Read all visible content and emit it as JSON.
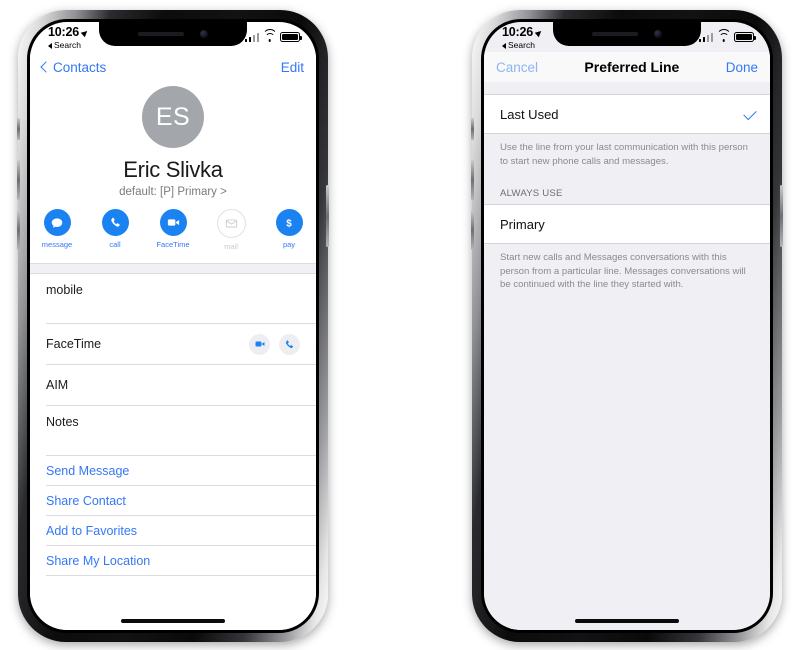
{
  "theme": {
    "accent_blue": "#3478f6",
    "action_blue": "#1b82f2",
    "check_blue": "#2e7cf0",
    "avatar_gray": "#a3a6ab",
    "screen_gray": "#efeff4",
    "separator": "#dcdce0",
    "footnote_gray": "#8a8a8f"
  },
  "status_bar": {
    "time": "10:26",
    "back_label": "Search",
    "location_icon": "location-arrow-icon",
    "signal_icon": "cellular-signal-icon",
    "wifi_icon": "wifi-icon",
    "battery_icon": "battery-icon"
  },
  "left_phone": {
    "nav": {
      "back_label": "Contacts",
      "edit_label": "Edit",
      "back_icon": "chevron-left-icon"
    },
    "contact": {
      "initials": "ES",
      "name": "Eric Slivka",
      "default_line": "default: [P] Primary >"
    },
    "actions": [
      {
        "label": "message",
        "icon": "message-bubble-icon",
        "disabled": false
      },
      {
        "label": "call",
        "icon": "phone-handset-icon",
        "disabled": false
      },
      {
        "label": "FaceTime",
        "icon": "video-camera-icon",
        "disabled": false
      },
      {
        "label": "mail",
        "icon": "envelope-icon",
        "disabled": true
      },
      {
        "label": "pay",
        "icon": "dollar-sign-icon",
        "disabled": false
      }
    ],
    "info_rows": [
      {
        "label": "mobile",
        "value": "",
        "tall": true,
        "icons": []
      },
      {
        "label": "FaceTime",
        "value": "",
        "tall": false,
        "icons": [
          "video-camera-icon",
          "phone-handset-icon"
        ]
      },
      {
        "label": "AIM",
        "value": "",
        "tall": false,
        "icons": []
      },
      {
        "label": "Notes",
        "value": "",
        "tall": true,
        "icons": []
      }
    ],
    "link_rows": [
      {
        "label": "Send Message"
      },
      {
        "label": "Share Contact"
      },
      {
        "label": "Add to Favorites"
      },
      {
        "label": "Share My Location"
      }
    ]
  },
  "right_phone": {
    "nav": {
      "cancel_label": "Cancel",
      "title": "Preferred Line",
      "done_label": "Done"
    },
    "last_used": {
      "label": "Last Used",
      "selected": true,
      "check_icon": "checkmark-icon",
      "footnote": "Use the line from your last communication with this person to start new phone calls and messages."
    },
    "always_use": {
      "header": "ALWAYS USE",
      "options": [
        {
          "label": "Primary",
          "selected": false
        }
      ],
      "footnote": "Start new calls and Messages conversations with this person from a particular line. Messages conversations will be continued with the line they started with."
    }
  }
}
